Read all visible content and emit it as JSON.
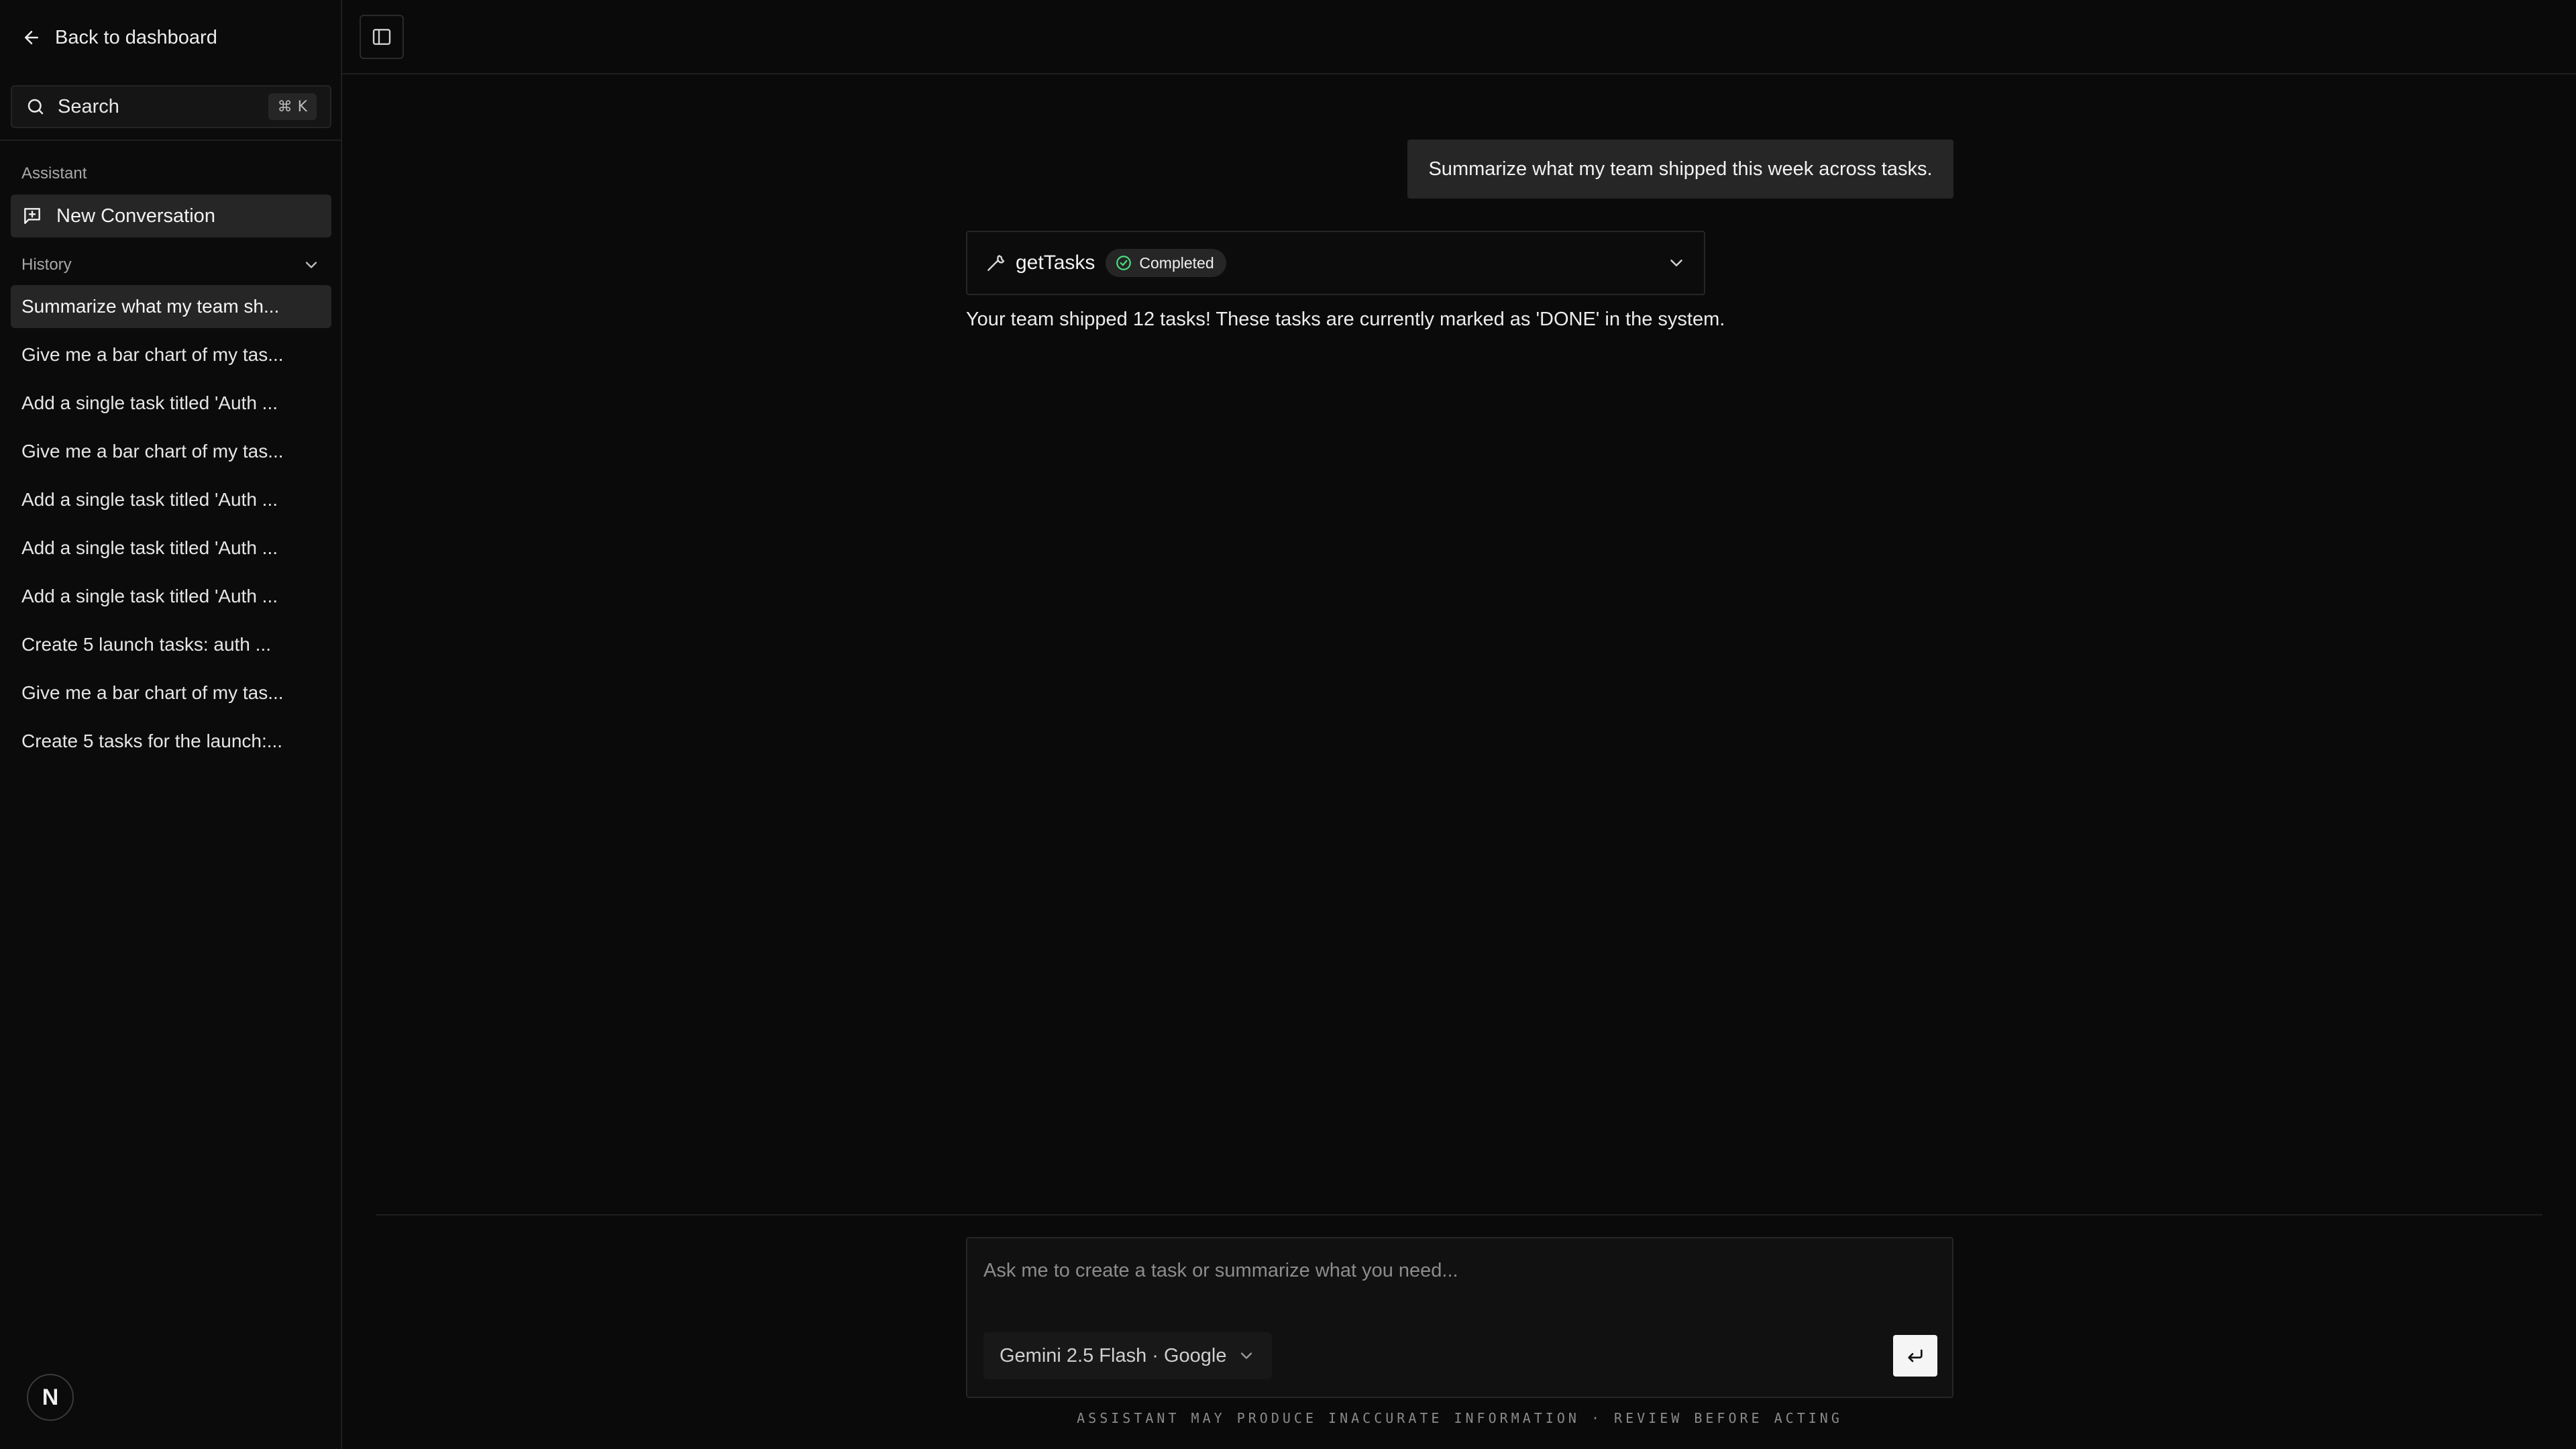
{
  "sidebar": {
    "back_label": "Back to dashboard",
    "search": {
      "label": "Search",
      "shortcut_symbol": "⌘",
      "shortcut_key": "K"
    },
    "assistant_label": "Assistant",
    "new_conversation_label": "New Conversation",
    "history_label": "History",
    "history": [
      "Summarize what my team sh...",
      "Give me a bar chart of my tas...",
      "Add a single task titled 'Auth ...",
      "Give me a bar chart of my tas...",
      "Add a single task titled 'Auth ...",
      "Add a single task titled 'Auth ...",
      "Add a single task titled 'Auth ...",
      "Create 5 launch tasks: auth ...",
      "Give me a bar chart of my tas...",
      "Create 5 tasks for the launch:..."
    ],
    "avatar_letter": "N"
  },
  "chat": {
    "user_message": "Summarize what my team shipped this week across tasks.",
    "tool": {
      "name": "getTasks",
      "status": "Completed"
    },
    "assistant_message": "Your team shipped 12 tasks! These tasks are currently marked as 'DONE' in the system."
  },
  "composer": {
    "placeholder": "Ask me to create a task or summarize what you need...",
    "model_label": "Gemini 2.5 Flash · Google",
    "disclaimer": "ASSISTANT MAY PRODUCE INACCURATE INFORMATION · REVIEW BEFORE ACTING"
  },
  "colors": {
    "background": "#0a0a0a",
    "panel": "#262626",
    "border": "#1f1f1f",
    "success": "#4ade80"
  }
}
